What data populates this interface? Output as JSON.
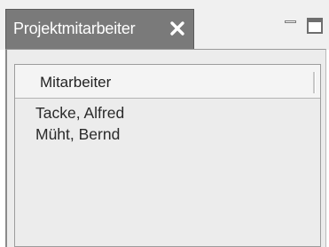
{
  "panel": {
    "tab": {
      "label": "Projektmitarbeiter",
      "close_icon": "close-icon"
    },
    "window_controls": {
      "minimize_icon": "minimize-icon",
      "maximize_icon": "maximize-icon"
    }
  },
  "list": {
    "column_header": "Mitarbeiter",
    "rows": [
      {
        "name": "Tacke, Alfred"
      },
      {
        "name": "Müht, Bernd"
      }
    ]
  },
  "colors": {
    "tab_background": "#7a7a7a",
    "tab_text": "#ffffff",
    "panel_background": "#ececec",
    "header_background": "#f4f4f4",
    "row_text": "#2a2a2a"
  }
}
